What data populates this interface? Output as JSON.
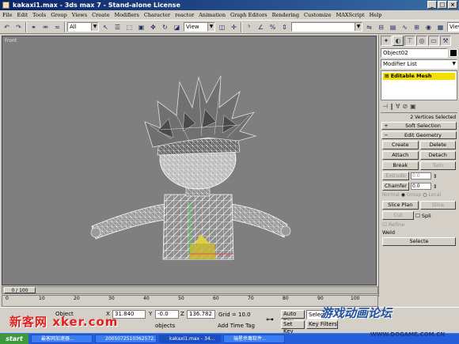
{
  "window": {
    "title": "kakaxi1.max - 3ds max 7 - Stand-alone License",
    "min": "_",
    "max": "□",
    "close": "×"
  },
  "menu": [
    "File",
    "Edit",
    "Tools",
    "Group",
    "Views",
    "Create",
    "Modifiers",
    "Character",
    "reactor",
    "Animation",
    "Graph Editors",
    "Rendering",
    "Customize",
    "MAXScript",
    "Help"
  ],
  "toolbar": {
    "selection_filter": "All",
    "coord_system": "View",
    "named_selection": "",
    "render_view": "View"
  },
  "viewport": {
    "label": "Front"
  },
  "command_panel": {
    "object_name": "Object02",
    "modifier_list": "Modifier List",
    "stack_item": "Editable Mesh",
    "selection_info": "2 Vertices Selected",
    "soft_selection": "Soft Selection",
    "edit_geometry": "Edit Geometry",
    "create": "Create",
    "delete": "Delete",
    "attach": "Attach",
    "detach": "Detach",
    "break": "Break",
    "turn": "Turn",
    "extrude": "Extrude",
    "extrude_val": "0.0",
    "chamfer": "Chamfer",
    "chamfer_val": "0.0",
    "normal": "Normal",
    "group": "Group",
    "local": "Local",
    "slice_plane": "Slice Plan",
    "slice": "Slice",
    "cut": "Cut",
    "split": "Spli",
    "refine": "Refine",
    "weld": "Weld",
    "selected": "Selecte"
  },
  "timeline": {
    "frame": "0 / 100",
    "ticks": [
      "0",
      "10",
      "20",
      "30",
      "40",
      "50",
      "60",
      "70",
      "80",
      "90",
      "100"
    ]
  },
  "status": {
    "object_label": "Object",
    "x_value": "31.840",
    "y_value": "-0.0",
    "z_value": "136.782",
    "grid": "Grid = 10.0",
    "auto_key": "Auto Key",
    "set_key": "Set Key",
    "key_mode": "Selected",
    "key_filters": "Key Filters",
    "add_time_tag": "Add Time Tag",
    "objects": "objects"
  },
  "taskbar": {
    "start": "start",
    "tasks": [
      "最客网加速器...",
      "2005072510362572...",
      "kakaxi1.max - 34...",
      "瑞星杀毒软件..."
    ]
  },
  "watermarks": {
    "left": "新客网 xker.com",
    "right": "游戏动画论坛",
    "url": "WWW.DOGAME.COM.CN"
  },
  "colors": {
    "viewport_bg": "#7f7f7f",
    "title_bar": "#0a246a",
    "stack_highlight": "#f4e000",
    "wireframe": "#ffffff"
  }
}
